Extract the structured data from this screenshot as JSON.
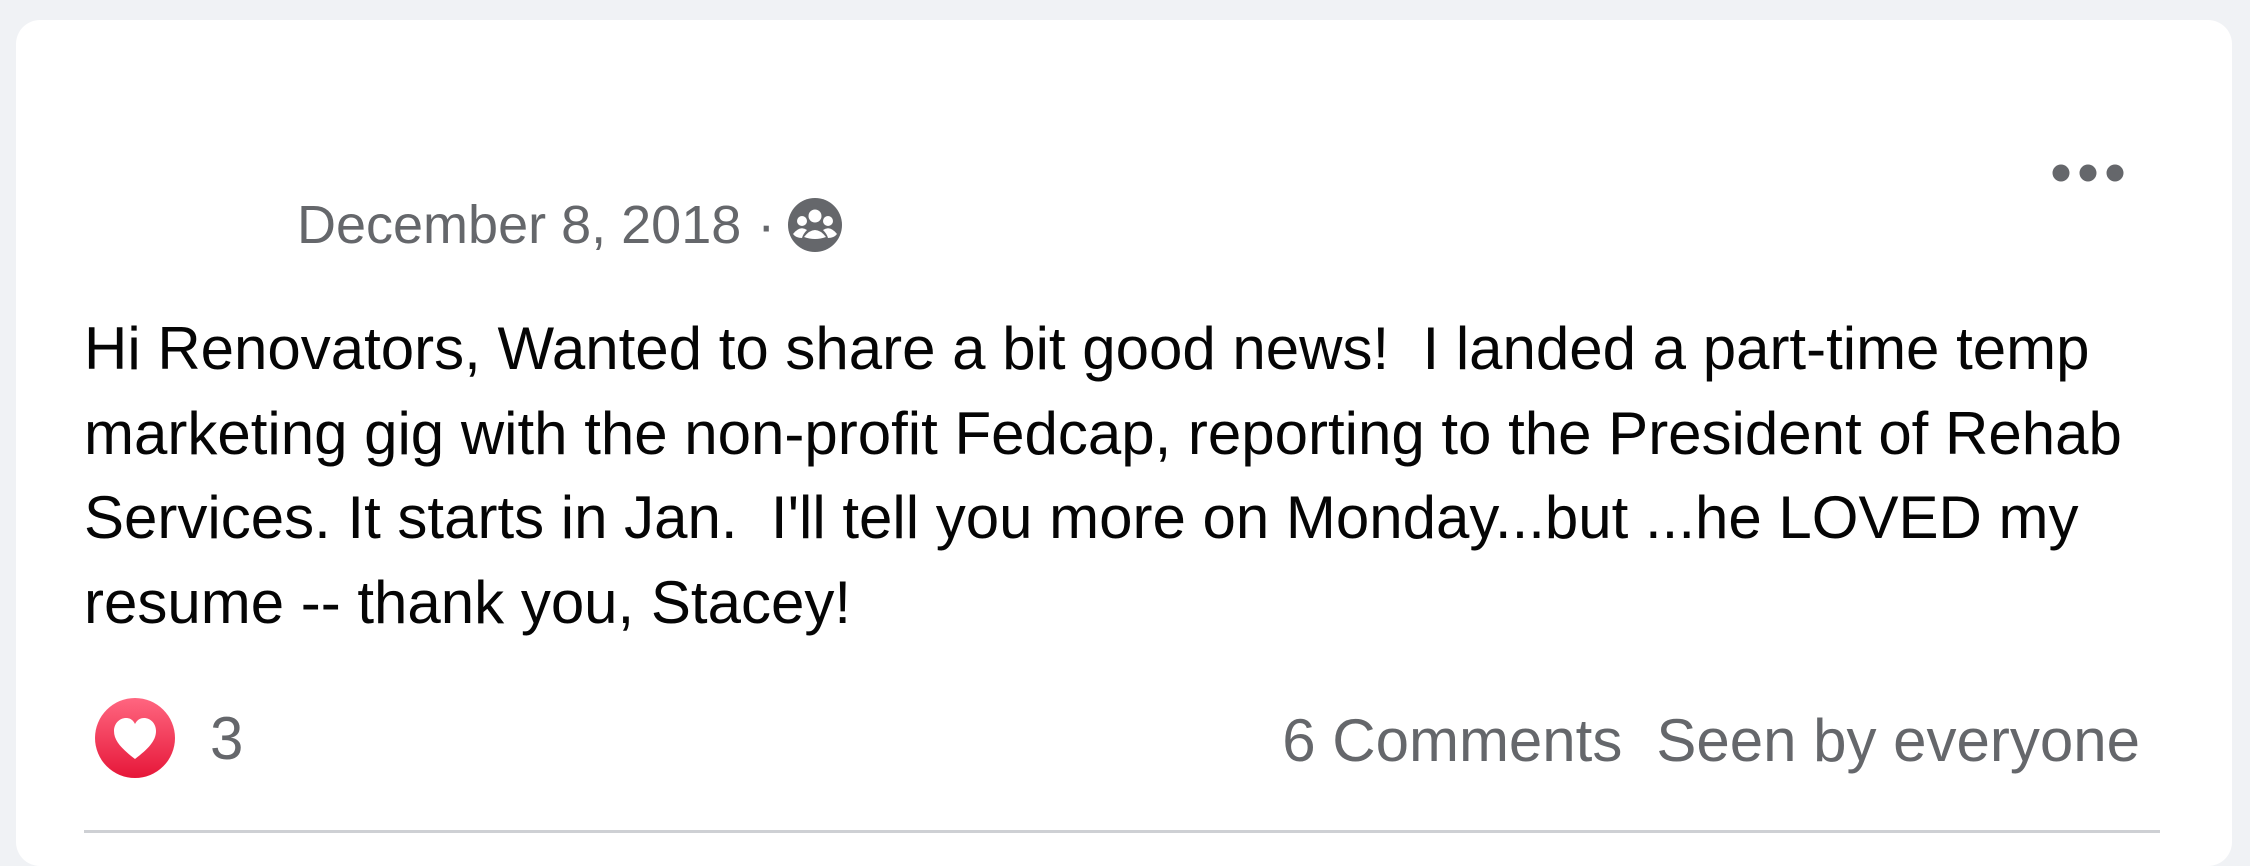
{
  "post": {
    "date": "December 8, 2018",
    "separator": "·",
    "privacy_icon": "group-members-icon",
    "text": "Hi Renovators, Wanted to share a bit good news!  I landed a part-time temp marketing gig with the non-profit Fedcap, reporting to the President of Rehab Services. It starts in Jan.  I'll tell you more on Monday...but ...he LOVED my resume -- thank you, Stacey!",
    "menu_icon": "more-options-icon"
  },
  "footer": {
    "reaction_icon": "love-reaction-icon",
    "reaction_count": "3",
    "comments": "6 Comments",
    "seen": "Seen by everyone"
  },
  "colors": {
    "background": "#f0f2f5",
    "card": "#ffffff",
    "text": "#050505",
    "secondary_text": "#65676b",
    "love_red": "#f02849",
    "divider": "#ced0d4"
  }
}
